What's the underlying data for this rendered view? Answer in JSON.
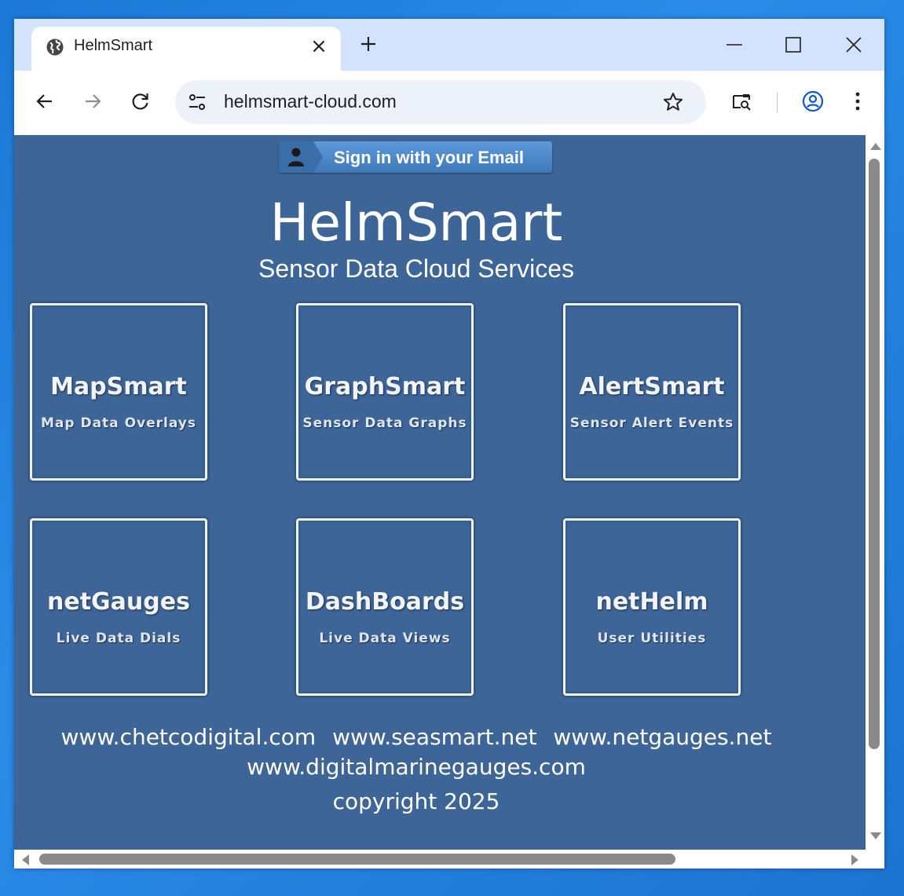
{
  "browser": {
    "tab": {
      "title": "HelmSmart",
      "close_glyph": "×"
    },
    "address_bar": {
      "url": "helmsmart-cloud.com"
    },
    "icons": [
      "globe-icon",
      "close-icon",
      "new-tab-icon",
      "minimize-icon",
      "maximize-icon",
      "window-close-icon",
      "back-arrow-icon",
      "forward-arrow-icon",
      "reload-icon",
      "site-info-icon",
      "bookmark-star-icon",
      "search-tab-icon",
      "profile-icon",
      "kebab-menu-icon"
    ]
  },
  "page": {
    "signin_label": "Sign in with your Email",
    "title": "HelmSmart",
    "subtitle": "Sensor Data Cloud Services",
    "tiles": [
      {
        "title": "MapSmart",
        "subtitle": "Map Data Overlays"
      },
      {
        "title": "GraphSmart",
        "subtitle": "Sensor Data Graphs"
      },
      {
        "title": "AlertSmart",
        "subtitle": "Sensor Alert Events"
      },
      {
        "title": "netGauges",
        "subtitle": "Live Data Dials"
      },
      {
        "title": "DashBoards",
        "subtitle": "Live Data Views"
      },
      {
        "title": "netHelm",
        "subtitle": "User Utilities"
      }
    ],
    "footer": {
      "links": [
        "www.chetcodigital.com",
        "www.seasmart.net",
        "www.netgauges.net",
        "www.digitalmarinegauges.com"
      ],
      "copyright": "copyright 2025"
    }
  },
  "colors": {
    "page_background": "#3d6597",
    "tab_strip": "#d3e3fd",
    "omnibox": "#edf2fa",
    "signin_button": "#4a86c7",
    "profile_icon": "#0b57d0",
    "desktop": "#1b78d6"
  }
}
